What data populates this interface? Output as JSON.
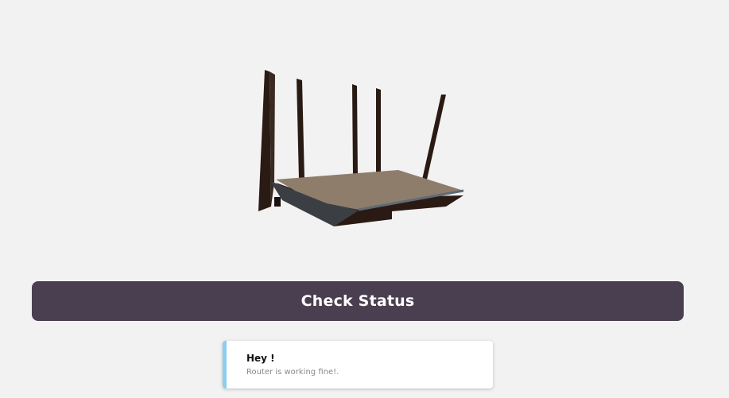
{
  "main": {
    "router_image": "router-illustration",
    "check_status_label": "Check Status"
  },
  "toast": {
    "title": "Hey !",
    "message": "Router is working fine!."
  },
  "colors": {
    "background": "#f2f2f2",
    "button": "#4a3f50",
    "button_text": "#ffffff",
    "toast_accent": "#8ecdf0",
    "router_top": "#8f7d6b",
    "router_body": "#2b1a14"
  }
}
